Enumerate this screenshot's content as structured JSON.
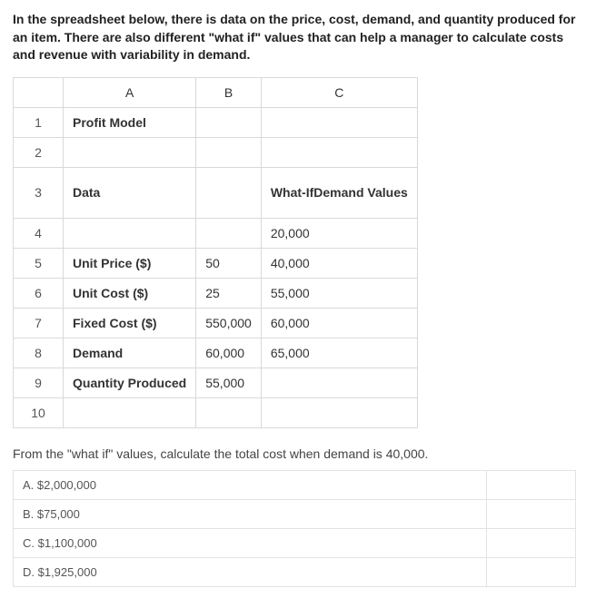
{
  "intro": "In the spreadsheet below, there is data on the price, cost, demand, and quantity produced for an item. There are also different \"what if\" values that can help a manager to calculate costs and revenue with variability in demand.",
  "columns": {
    "A": "A",
    "B": "B",
    "C": "C"
  },
  "rows": {
    "r1": {
      "n": "1",
      "A": "Profit Model",
      "B": "",
      "C": ""
    },
    "r2": {
      "n": "2",
      "A": "",
      "B": "",
      "C": ""
    },
    "r3": {
      "n": "3",
      "A": "Data",
      "B": "",
      "C": "What-IfDemand Values"
    },
    "r4": {
      "n": "4",
      "A": "",
      "B": "",
      "C": "20,000"
    },
    "r5": {
      "n": "5",
      "A": "Unit Price ($)",
      "B": "50",
      "C": "40,000"
    },
    "r6": {
      "n": "6",
      "A": "Unit Cost ($)",
      "B": "25",
      "C": "55,000"
    },
    "r7": {
      "n": "7",
      "A": "Fixed Cost ($)",
      "B": "550,000",
      "C": "60,000"
    },
    "r8": {
      "n": "8",
      "A": "Demand",
      "B": "60,000",
      "C": "65,000"
    },
    "r9": {
      "n": "9",
      "A": "Quantity Produced",
      "B": "55,000",
      "C": ""
    },
    "r10": {
      "n": "10",
      "A": "",
      "B": "",
      "C": ""
    }
  },
  "question": "From the \"what if\" values, calculate the total cost when demand is 40,000.",
  "options": {
    "A": "A. $2,000,000",
    "B": "B. $75,000",
    "C": "C. $1,100,000",
    "D": "D. $1,925,000"
  }
}
